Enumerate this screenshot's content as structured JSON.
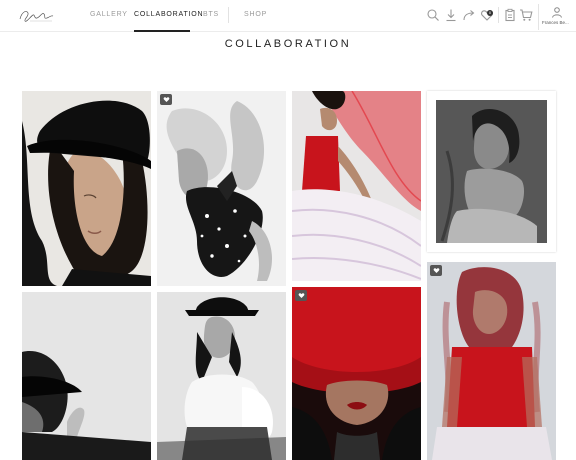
{
  "brand": {
    "logo_text": "Frances Betty"
  },
  "nav": [
    {
      "label": "GALLERY",
      "active": false
    },
    {
      "label": "COLLABORATION",
      "active": true
    },
    {
      "label": "BTS",
      "active": false
    },
    {
      "label": "SHOP",
      "active": false
    }
  ],
  "toolbar": {
    "icons": [
      "search-icon",
      "download-icon",
      "share-icon",
      "favorites-icon",
      "clipboard-icon",
      "cart-icon"
    ],
    "favorites_count": "0"
  },
  "user": {
    "name": "Frances Be..."
  },
  "page": {
    "title": "COLLABORATION"
  },
  "photos": [
    {
      "subject": "woman in black fedora, eyes closed",
      "favorited": false
    },
    {
      "subject": "abstract motion blur of hand with sequins",
      "favorited": true
    },
    {
      "subject": "woman in red corset and red tulle",
      "favorited": false
    },
    {
      "subject": "sepia charcoal portrait in tutu",
      "favorited": false
    },
    {
      "subject": "silhouette in black hat against wall",
      "favorited": false
    },
    {
      "subject": "black and white portrait in hat and puff sleeves",
      "favorited": false
    },
    {
      "subject": "red wide-brim hat covering face",
      "favorited": true
    },
    {
      "subject": "motion blurred woman in red top",
      "favorited": true
    }
  ],
  "colors": {
    "accent_red": "#c8141c",
    "text_dark": "#222222",
    "nav_muted": "#9a9a9a"
  }
}
